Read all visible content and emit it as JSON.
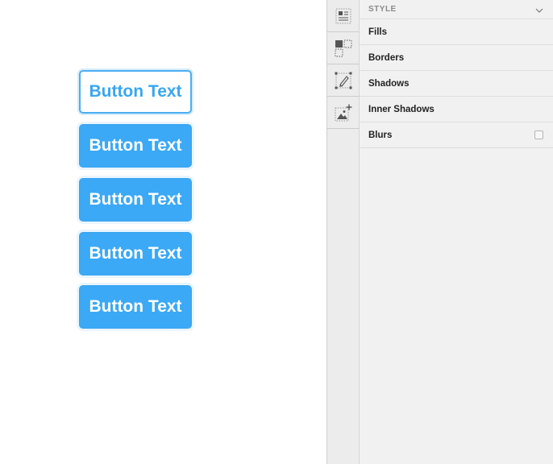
{
  "canvas": {
    "buttons": [
      {
        "label": "Button Text",
        "variant": "outline"
      },
      {
        "label": "Button Text",
        "variant": "filled"
      },
      {
        "label": "Button Text",
        "variant": "filled"
      },
      {
        "label": "Button Text",
        "variant": "filled"
      },
      {
        "label": "Button Text",
        "variant": "filled"
      }
    ]
  },
  "toolbar": {
    "tools": [
      {
        "icon": "style-icon"
      },
      {
        "icon": "components-icon"
      },
      {
        "icon": "edit-path-icon"
      },
      {
        "icon": "add-image-icon"
      }
    ]
  },
  "panel": {
    "header": "STYLE",
    "rows": {
      "fills": "Fills",
      "borders": "Borders",
      "shadows": "Shadows",
      "inner_shadows": "Inner Shadows",
      "blurs": "Blurs"
    }
  },
  "colors": {
    "button_blue": "#3ba9f5",
    "button_text_outline": "#3aa6ee",
    "panel_bg": "#f1f1f1",
    "toolbar_bg": "#ececec"
  }
}
